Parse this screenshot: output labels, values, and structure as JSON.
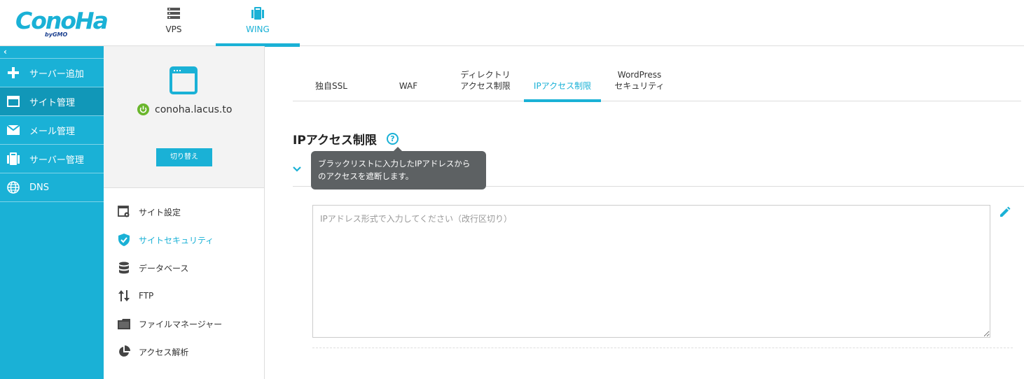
{
  "brand": {
    "logo": "ConoHa",
    "logo_sub": "byGMO",
    "color": "#1ab1d6"
  },
  "topnav": [
    {
      "label": "VPS",
      "icon": "server-icon",
      "active": false
    },
    {
      "label": "WING",
      "icon": "wing-server-icon",
      "active": true
    }
  ],
  "sidebar": {
    "collapse": "‹",
    "items": [
      {
        "label": "サーバー追加",
        "icon": "plus-icon"
      },
      {
        "label": "サイト管理",
        "icon": "window-icon",
        "active": true
      },
      {
        "label": "メール管理",
        "icon": "mail-icon"
      },
      {
        "label": "サーバー管理",
        "icon": "server-mgmt-icon"
      },
      {
        "label": "DNS",
        "icon": "globe-icon"
      }
    ]
  },
  "site": {
    "domain": "conoha.lacus.to",
    "switch_label": "切り替え"
  },
  "menu": [
    {
      "label": "サイト設定",
      "icon": "site-settings-icon"
    },
    {
      "label": "サイトセキュリティ",
      "icon": "shield-icon",
      "active": true
    },
    {
      "label": "データベース",
      "icon": "database-icon"
    },
    {
      "label": "FTP",
      "icon": "transfer-icon"
    },
    {
      "label": "ファイルマネージャー",
      "icon": "folder-icon"
    },
    {
      "label": "アクセス解析",
      "icon": "pie-chart-icon"
    }
  ],
  "tabs": [
    {
      "label": "独自SSL"
    },
    {
      "label": "WAF"
    },
    {
      "label": "ディレクトリ\nアクセス制限"
    },
    {
      "label": "IPアクセス制限",
      "active": true
    },
    {
      "label": "WordPress\nセキュリティ"
    }
  ],
  "section": {
    "title": "IPアクセス制限",
    "help": "?",
    "tooltip_line1": "ブラックリストに入力したIPアドレスから",
    "tooltip_line2": "のアクセスを遮断します。"
  },
  "ip_input": {
    "placeholder": "IPアドレス形式で入力してください（改行区切り）",
    "value": ""
  }
}
